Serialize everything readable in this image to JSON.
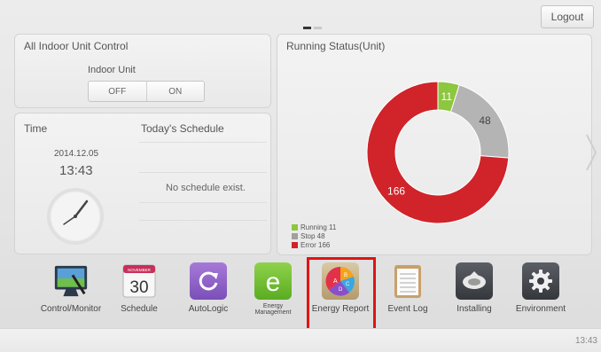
{
  "header": {
    "logout_label": "Logout"
  },
  "control_panel": {
    "title": "All Indoor Unit Control",
    "indoor_unit_label": "Indoor Unit",
    "off_label": "OFF",
    "on_label": "ON"
  },
  "time_panel": {
    "title": "Time",
    "schedule_title": "Today's Schedule",
    "date": "2014.12.05",
    "time": "13:43",
    "no_schedule": "No schedule exist."
  },
  "status_panel": {
    "title": "Running Status(Unit)",
    "segments": [
      {
        "label": "11",
        "value": 11,
        "color": "#8dc63f"
      },
      {
        "label": "48",
        "value": 48,
        "color": "#b4b4b4"
      },
      {
        "label": "166",
        "value": 166,
        "color": "#d0232a"
      }
    ],
    "legend": [
      {
        "text": "Running 11",
        "color": "#8dc63f"
      },
      {
        "text": "Stop 48",
        "color": "#a0a0a0"
      },
      {
        "text": "Error 166",
        "color": "#d0232a"
      }
    ]
  },
  "toolbar": {
    "items": [
      {
        "label": "Control/Monitor",
        "icon": "monitor-icon"
      },
      {
        "label": "Schedule",
        "icon": "calendar-icon",
        "calendar_month": "NOVEMBER",
        "calendar_day": "30"
      },
      {
        "label": "AutoLogic",
        "icon": "refresh-icon"
      },
      {
        "label": "Energy Management",
        "icon": "energy-e-icon"
      },
      {
        "label": "Energy Report",
        "icon": "pie-chart-icon"
      },
      {
        "label": "Event Log",
        "icon": "notepad-icon"
      },
      {
        "label": "Installing",
        "icon": "ceiling-unit-icon"
      },
      {
        "label": "Environment",
        "icon": "gear-icon"
      }
    ]
  },
  "footer": {
    "time": "13:43"
  }
}
